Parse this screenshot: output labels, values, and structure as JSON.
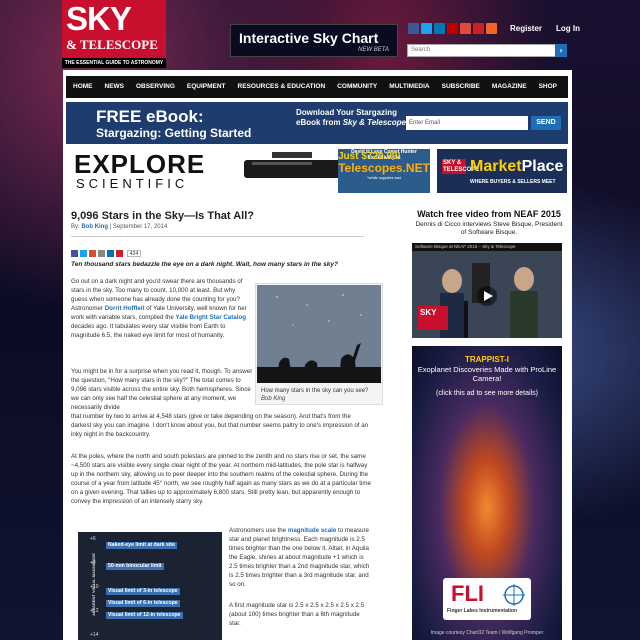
{
  "header": {
    "logo": {
      "line1": "SKY",
      "line2": "& TELESCOPE",
      "tagline": "THE ESSENTIAL GUIDE TO ASTRONOMY"
    },
    "sky_chart": {
      "title": "Interactive Sky Chart",
      "badge": "NEW BETA"
    },
    "register": "Register",
    "login": "Log In",
    "search_placeholder": "Search"
  },
  "nav": [
    "HOME",
    "NEWS",
    "OBSERVING",
    "EQUIPMENT",
    "RESOURCES & EDUCATION",
    "COMMUNITY",
    "MULTIMEDIA",
    "SUBSCRIBE",
    "MAGAZINE",
    "SHOP"
  ],
  "ebook": {
    "headline": "FREE eBook:",
    "subhead": "Stargazing: Getting Started",
    "download": "Download Your Stargazing eBook from",
    "brand": "Sky & Telescope",
    "email_placeholder": "Enter Email",
    "send": "SEND"
  },
  "ads": {
    "explore": {
      "line1": "EXPLORE",
      "line2": "SCIENTIFIC"
    },
    "telescopes": {
      "price": "Just $729.99!",
      "line": "David H Levy Comet Hunter Exclusively at",
      "site": "Telescopes.NET",
      "note": "*while supplies last"
    },
    "marketplace": {
      "badge": "SKY & TELESCOPE",
      "title1": "Market",
      "title2": "Place",
      "sub": "WHERE BUYERS & SELLERS MEET"
    }
  },
  "article": {
    "title": "9,096 Stars in the Sky—Is That All?",
    "by_label": "By:",
    "author": "Bob King",
    "date": "| September 17, 2014",
    "share_count": "424",
    "lead": "Ten thousand stars bedazzle the eye on a  dark night. Wait, how many stars in the sky?",
    "p1a": "Go out on a dark night and you'd swear there are thousands of stars in the sky. Too many to count. 10,000 at least. But why guess when someone has already done the counting for you? Astronomer ",
    "p1_link1": "Dorrit Hoffleit",
    "p1b": " of Yale University, well known for her work with variable stars, compiled the ",
    "p1_link2": "Yale Bright Star Catalog",
    "p1c": " decades ago. It tabulates every star visible from Earth to magnitude 6.5, the naked eye limit for most of humanity.",
    "p2a": "You might be in for a surprise when you read it, though. To answer the question, \"How many stars in the sky?\" The total comes to 9,096 stars visible across the entire sky. Both hemispheres. Since we can only see half the celestial sphere at any moment, we necessarily divide",
    "p2b": "that number by two to arrive at 4,548 stars (give or take depending on the season). And that's from the darkest sky you can imagine. I don't know about you, but that number seems paltry to one's impression of an inky night in the backcountry.",
    "p3": "At the poles, where the north and south polestars are pinned to the zenith and no stars rise or set, the same ~4,500 stars are visible every single clear night of the year. At northern mid-latitudes, the pole star is halfway up in the northern sky, allowing us to peer deeper into the southern realms of the celestial sphere. During the course of a year from latitude 45° north, we see roughly half again as many stars as we do at a particular time on a given evening. That tallies up to approximately 6,800 stars. Still pretty lean, but apparently enough to convey the impression of an intensely starry sky.",
    "p4a": "Astronomers use the ",
    "p4_link": "magnitude scale",
    "p4b": " to measure star and planet brightness. Each magnitude is 2.5 times brighter than the one below it. Altair, in Aquila the Eagle, shines at about magnitude +1 which is 2.5 times brighter than a 2nd magnitude star, which is 2.5 times brighter than a 3rd magnitude star, and so on.",
    "p5": "A first magnitude star is 2.5 x 2.5 x 2.5 x 2.5 x 2.5 (about 100) times brighter than a 6th magnitude star.",
    "caption": "How many stars in the sky can you see?",
    "caption_credit": "Bob King",
    "figure": {
      "axis": "APPARENT VISUAL MAGNITUDE",
      "ticks": [
        "+6",
        "+8",
        "+10",
        "+12",
        "+14"
      ],
      "rows": [
        "Naked-eye limit at dark site",
        "50-mm binocular limit",
        "Visual limit of 3-in telescope",
        "Visual limit of 6-in telescope",
        "Visual limit of 12-in telescope"
      ]
    }
  },
  "sidebar": {
    "video_title": "Watch free video from NEAF 2015",
    "video_desc": "Dennis di Cicco interviews Steve Bisque, President of Software Bisque.",
    "video_bar": "Software Bisque at NEAF 2015 – Sky & Telescope",
    "video_logo": "SKY",
    "fli": {
      "line1": "TRAPPIST-I",
      "line2": "Exoplanet Discoveries Made with ProLine Camera!",
      "line3": "(click this ad to see more details)",
      "logo": "FLI",
      "logo_sub": "Finger Lakes Instrumentation",
      "credit": "Image courtesy Chart32 Team / Wolfgang Promper"
    }
  },
  "colors": {
    "brand_red": "#c8102e",
    "link_blue": "#1e6fb8",
    "nav_black": "#111111",
    "banner_blue": "#1e3c6e"
  }
}
